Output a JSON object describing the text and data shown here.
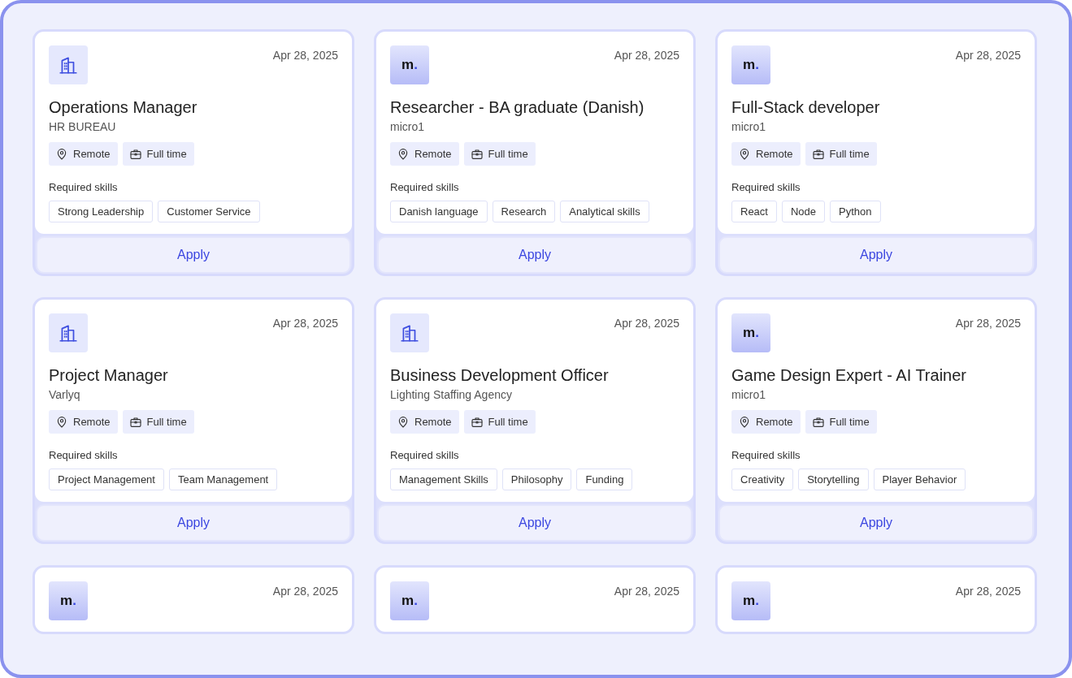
{
  "jobs": [
    {
      "logo": {
        "kind": "building"
      },
      "date": "Apr 28, 2025",
      "title": "Operations Manager",
      "company": "HR BUREAU",
      "tags": [
        {
          "kind": "location",
          "text": "Remote"
        },
        {
          "kind": "type",
          "text": "Full time"
        }
      ],
      "skills_label": "Required skills",
      "skills": [
        "Strong Leadership",
        "Customer Service"
      ],
      "action": "Apply"
    },
    {
      "logo": {
        "kind": "wordmark",
        "text": "m."
      },
      "date": "Apr 28, 2025",
      "title": "Researcher - BA graduate (Danish)",
      "company": "micro1",
      "tags": [
        {
          "kind": "location",
          "text": "Remote"
        },
        {
          "kind": "type",
          "text": "Full time"
        }
      ],
      "skills_label": "Required skills",
      "skills": [
        "Danish language",
        "Research",
        "Analytical skills"
      ],
      "action": "Apply"
    },
    {
      "logo": {
        "kind": "wordmark",
        "text": "m."
      },
      "date": "Apr 28, 2025",
      "title": "Full-Stack developer",
      "company": "micro1",
      "tags": [
        {
          "kind": "location",
          "text": "Remote"
        },
        {
          "kind": "type",
          "text": "Full time"
        }
      ],
      "skills_label": "Required skills",
      "skills": [
        "React",
        "Node",
        "Python"
      ],
      "action": "Apply"
    },
    {
      "logo": {
        "kind": "building"
      },
      "date": "Apr 28, 2025",
      "title": "Project Manager",
      "company": "Varlyq",
      "tags": [
        {
          "kind": "location",
          "text": "Remote"
        },
        {
          "kind": "type",
          "text": "Full time"
        }
      ],
      "skills_label": "Required skills",
      "skills": [
        "Project Management",
        "Team Management"
      ],
      "action": "Apply"
    },
    {
      "logo": {
        "kind": "building"
      },
      "date": "Apr 28, 2025",
      "title": "Business Development Officer",
      "company": "Lighting Staffing Agency",
      "tags": [
        {
          "kind": "location",
          "text": "Remote"
        },
        {
          "kind": "type",
          "text": "Full time"
        }
      ],
      "skills_label": "Required skills",
      "skills": [
        "Management Skills",
        "Philosophy",
        "Funding"
      ],
      "action": "Apply"
    },
    {
      "logo": {
        "kind": "wordmark",
        "text": "m."
      },
      "date": "Apr 28, 2025",
      "title": "Game Design Expert - AI Trainer",
      "company": "micro1",
      "tags": [
        {
          "kind": "location",
          "text": "Remote"
        },
        {
          "kind": "type",
          "text": "Full time"
        }
      ],
      "skills_label": "Required skills",
      "skills": [
        "Creativity",
        "Storytelling",
        "Player Behavior"
      ],
      "action": "Apply"
    },
    {
      "logo": {
        "kind": "wordmark",
        "text": "m."
      },
      "date": "Apr 28, 2025"
    },
    {
      "logo": {
        "kind": "wordmark",
        "text": "m."
      },
      "date": "Apr 28, 2025"
    },
    {
      "logo": {
        "kind": "wordmark",
        "text": "m."
      },
      "date": "Apr 28, 2025"
    }
  ]
}
